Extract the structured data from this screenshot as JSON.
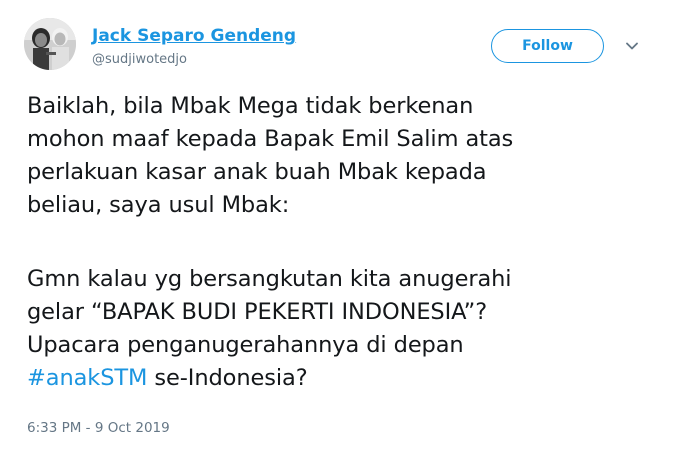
{
  "author": {
    "display_name": "Jack Separo Gendeng",
    "handle": "@sudjiwotedjo"
  },
  "follow_button": {
    "label": "Follow"
  },
  "tweet": {
    "paragraph1": [
      "Baiklah, bila Mbak Mega tidak berkenan",
      "mohon maaf kepada Bapak Emil Salim atas",
      "perlakuan kasar anak buah Mbak kepada",
      "beliau, saya usul Mbak:"
    ],
    "paragraph2": [
      "Gmn kalau yg bersangkutan kita anugerahi",
      "gelar “BAPAK BUDI PEKERTI INDONESIA”?",
      "Upacara penganugerahannya di depan"
    ],
    "hashtag": "#anakSTM",
    "last_line_suffix": " se-Indonesia?"
  },
  "timestamp": "6:33 PM - 9 Oct 2019",
  "colors": {
    "link": "#1b95e0",
    "text": "#14171a",
    "muted": "#657786"
  },
  "icons": {
    "caret": "chevron-down-icon",
    "avatar": "avatar"
  }
}
